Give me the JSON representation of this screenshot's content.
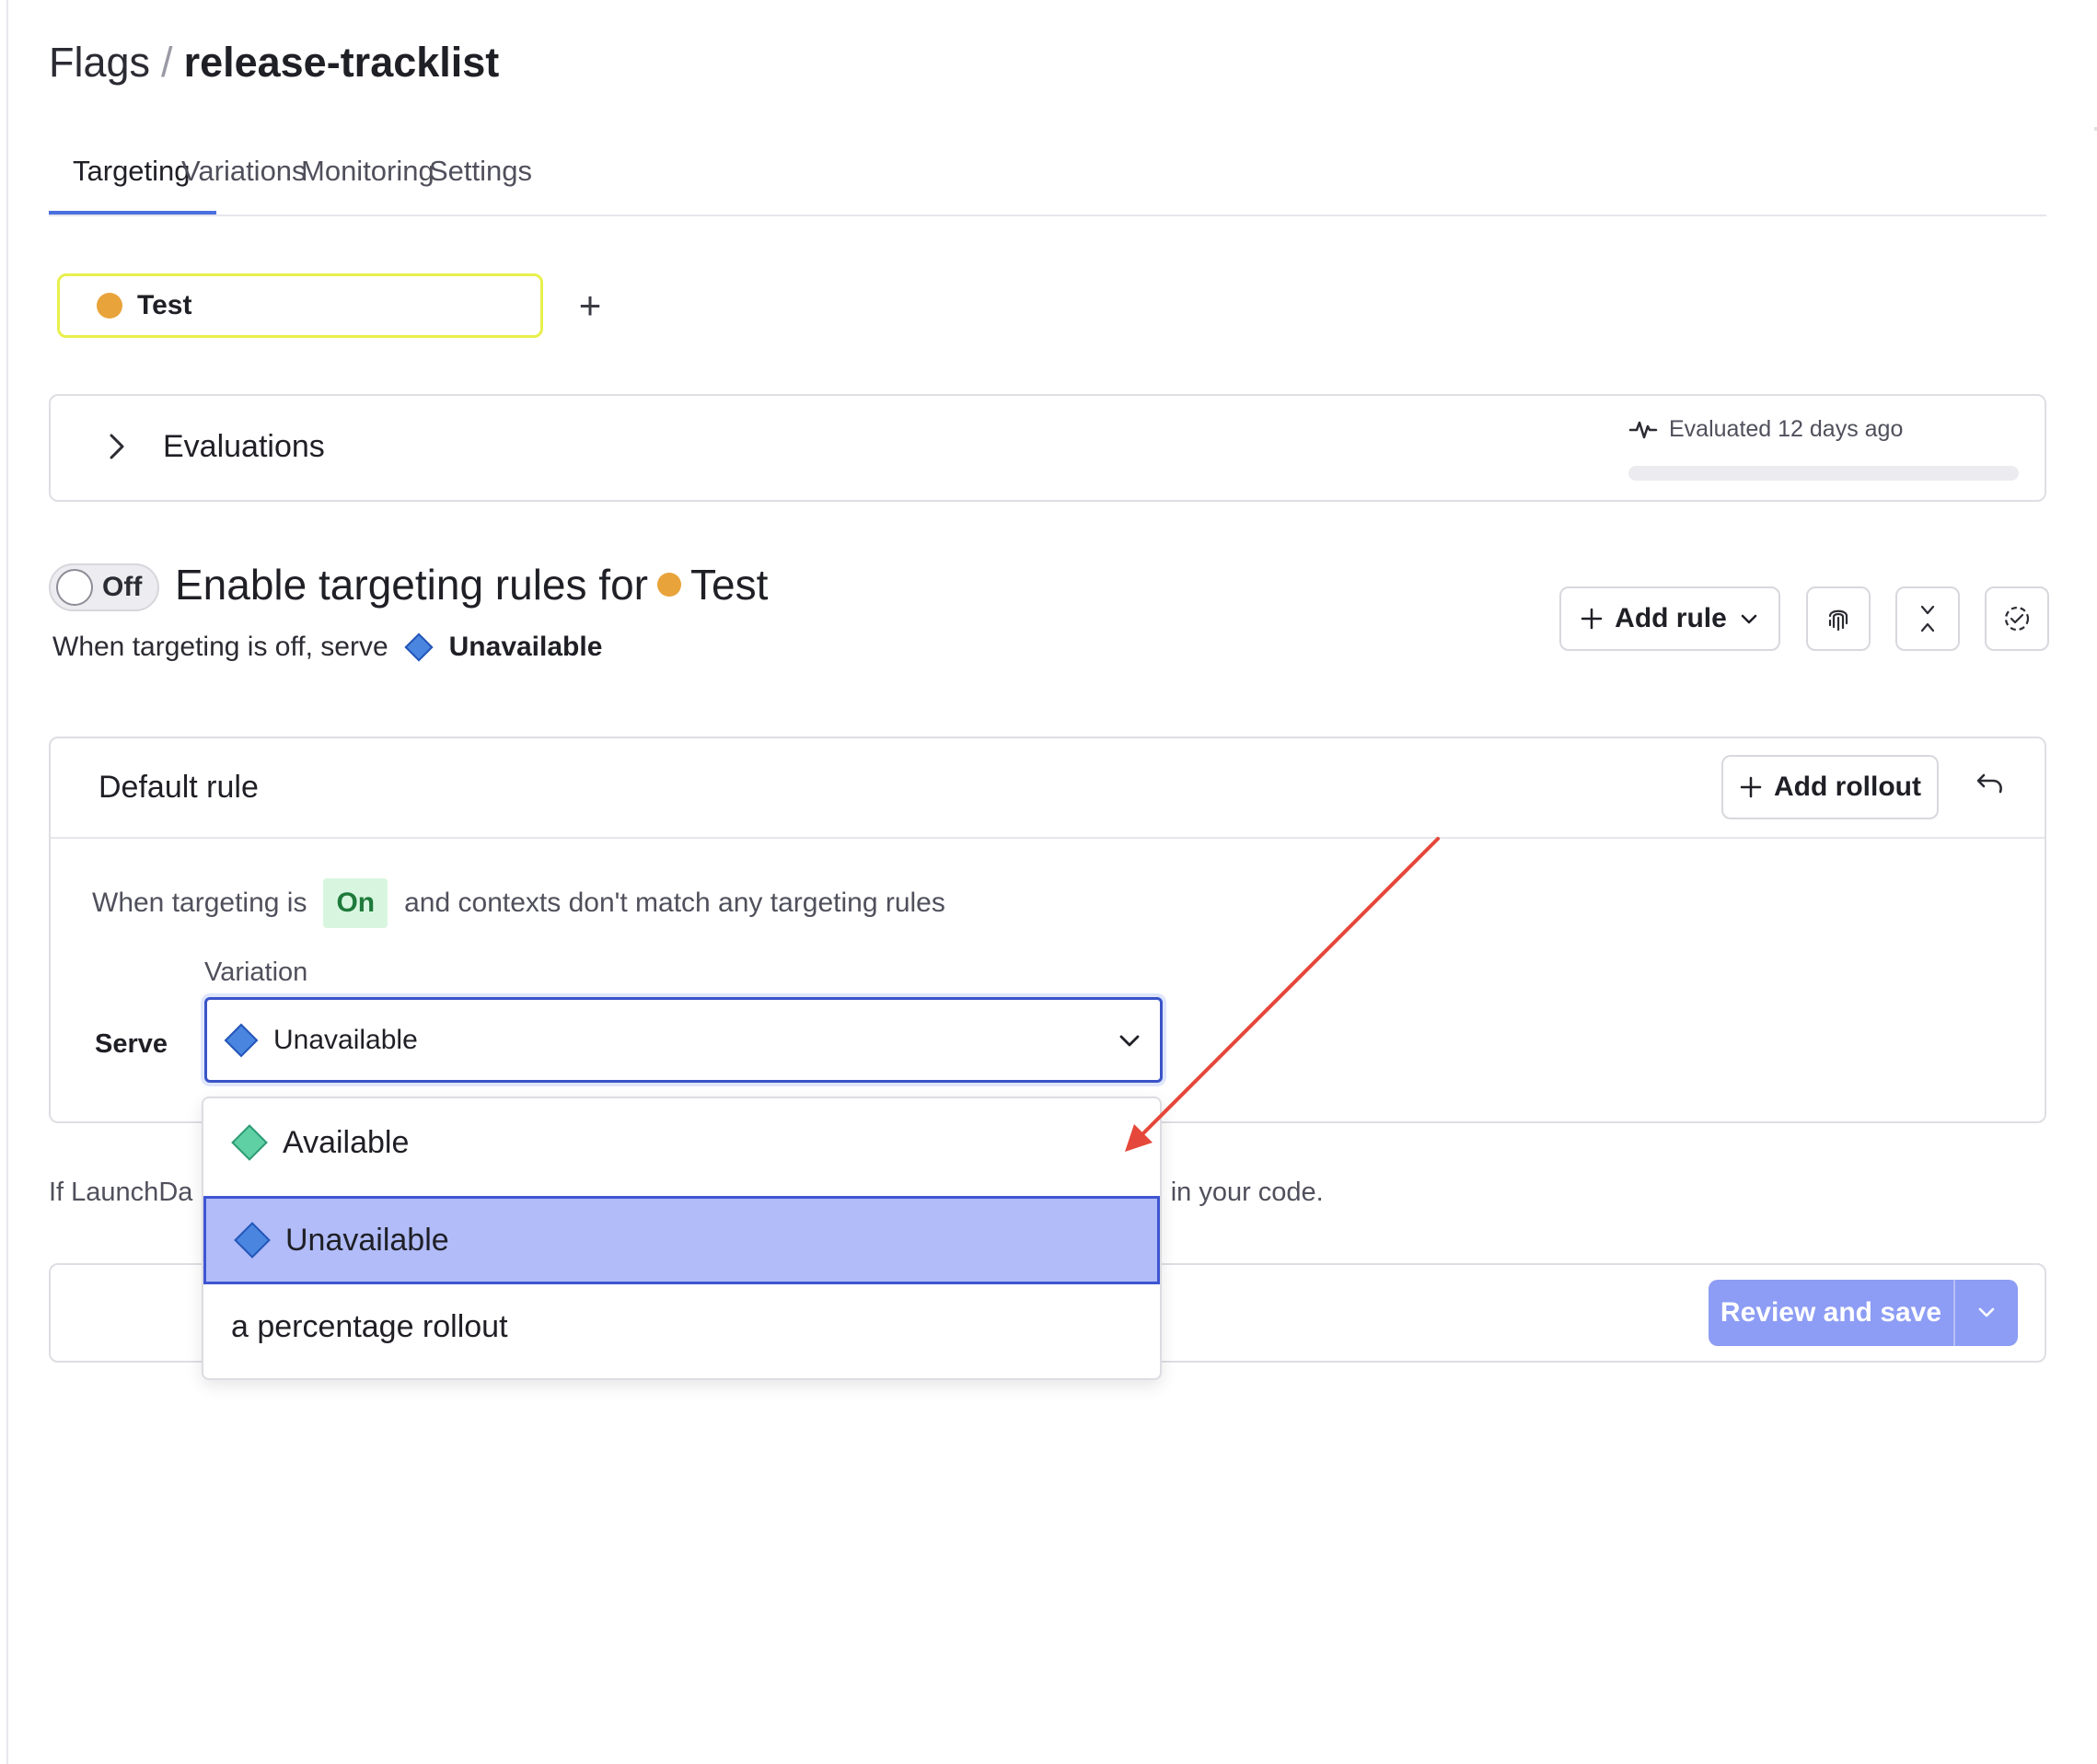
{
  "breadcrumb": {
    "root": "Flags",
    "separator": "/",
    "current": "release-tracklist"
  },
  "tabs": [
    {
      "label": "Targeting",
      "active": true
    },
    {
      "label": "Variations",
      "active": false
    },
    {
      "label": "Monitoring",
      "active": false
    },
    {
      "label": "Settings",
      "active": false
    }
  ],
  "environment": {
    "label": "Test",
    "color": "#e8a33a",
    "add_icon": "plus-icon"
  },
  "evaluations": {
    "title": "Evaluations",
    "meta": "Evaluated 12 days ago"
  },
  "targeting": {
    "toggle_label": "Off",
    "heading_prefix": "Enable targeting rules for",
    "heading_env": "Test",
    "off_serve_prefix": "When targeting is off, serve",
    "off_serve_value": "Unavailable"
  },
  "toolbar": {
    "add_rule_label": "Add rule"
  },
  "default_rule": {
    "title": "Default rule",
    "add_rollout_label": "Add rollout",
    "when_prefix": "When targeting is",
    "on_badge": "On",
    "when_suffix": "and contexts don't match any targeting rules",
    "variation_label": "Variation",
    "serve_label": "Serve",
    "selected_value": "Unavailable"
  },
  "dropdown": {
    "options": [
      {
        "label": "Available",
        "icon": "green-diamond-icon",
        "selected": false
      },
      {
        "label": "Unavailable",
        "icon": "blue-diamond-icon",
        "selected": true
      },
      {
        "label": "a percentage rollout",
        "icon": "",
        "selected": false
      }
    ]
  },
  "fallback": {
    "text_start": "If LaunchDa",
    "text_end": "d in your code."
  },
  "save": {
    "label": "Review and save"
  },
  "colors": {
    "accent": "#4a6fe0",
    "selected_option_bg": "#b1bcf8",
    "save_button": "#8d9cf4",
    "env_chip_border": "#e8f04c",
    "on_badge_bg": "#d8f6df",
    "annotation_arrow": "#e5483a"
  }
}
